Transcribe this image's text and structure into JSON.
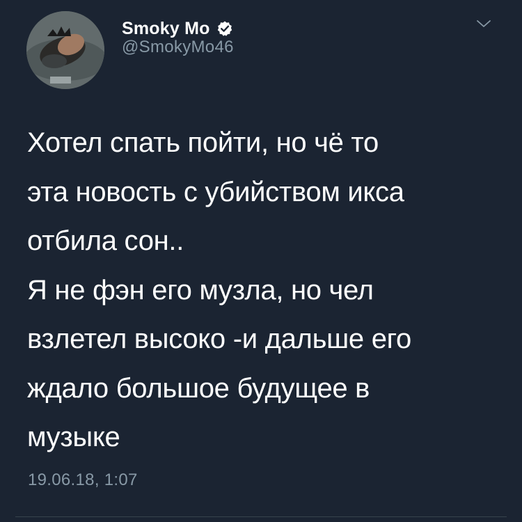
{
  "author": {
    "name": "Smoky Mo",
    "handle": "@SmokyMo46",
    "verified": true,
    "avatar_icon": "profile-photo"
  },
  "tweet": {
    "lines": [
      "Хотел спать пойти, но чё то",
      "эта новость с убийством икса",
      "отбила сон..",
      "Я не фэн его музла, но чел",
      "взлетел высоко -и дальше его",
      "ждало большое будущее в",
      "музыке"
    ],
    "timestamp": "19.06.18, 1:07"
  },
  "colors": {
    "background": "#1b2432",
    "text": "#ffffff",
    "secondary_text": "#8899a6",
    "verified_badge": "#ffffff",
    "divider": "#38444d"
  },
  "icons": {
    "verified": "verified-badge-icon",
    "menu": "chevron-down-icon"
  }
}
